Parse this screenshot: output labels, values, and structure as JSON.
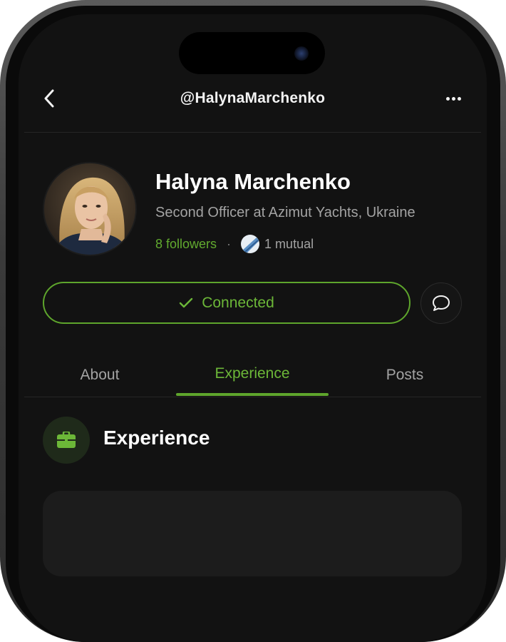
{
  "header": {
    "handle": "@HalynaMarchenko"
  },
  "profile": {
    "name": "Halyna Marchenko",
    "title": "Second Officer at Azimut Yachts, Ukraine",
    "followers": "8 followers",
    "separator": "·",
    "mutual": "1 mutual"
  },
  "actions": {
    "connected_label": "Connected"
  },
  "tabs": [
    {
      "label": "About"
    },
    {
      "label": "Experience"
    },
    {
      "label": "Posts"
    }
  ],
  "active_tab": "Experience",
  "section": {
    "heading": "Experience"
  },
  "colors": {
    "background": "#121212",
    "accent": "#62ab2f",
    "text_primary": "#ffffff",
    "text_secondary": "#a3a3a3"
  },
  "icons": {
    "back": "chevron-left-icon",
    "more": "more-horizontal-icon",
    "check": "check-icon",
    "message": "chat-bubble-icon",
    "briefcase": "briefcase-icon"
  }
}
